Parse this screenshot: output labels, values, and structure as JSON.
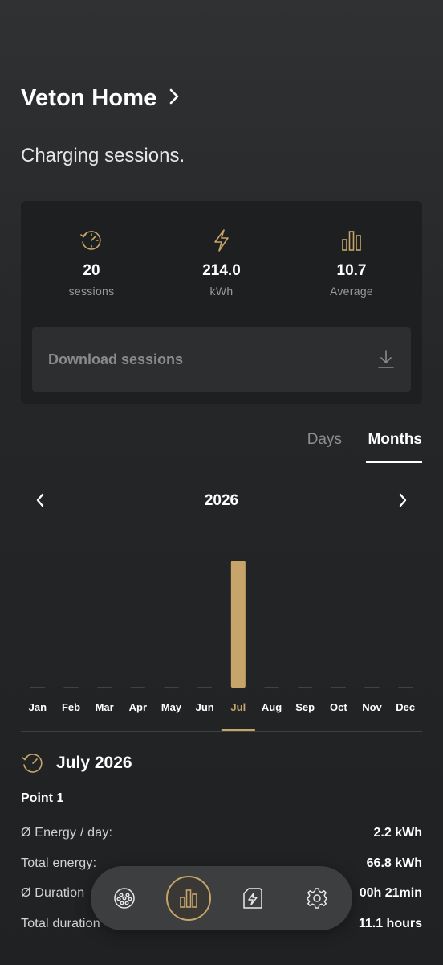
{
  "header": {
    "title": "Veton Home"
  },
  "subtitle": "Charging sessions.",
  "stats": [
    {
      "icon": "history-clock-icon",
      "value": "20",
      "label": "sessions"
    },
    {
      "icon": "lightning-icon",
      "value": "214.0",
      "label": "kWh"
    },
    {
      "icon": "bar-chart-icon",
      "value": "10.7",
      "label": "Average"
    }
  ],
  "download": {
    "label": "Download sessions",
    "icon": "download-icon"
  },
  "tabs": {
    "days": "Days",
    "months": "Months",
    "active": "Months"
  },
  "year_nav": {
    "year": "2026"
  },
  "colors": {
    "accent": "#c6a46a",
    "card": "#1d1f21",
    "background": "#2a2c2e"
  },
  "chart_data": {
    "type": "bar",
    "categories": [
      "Jan",
      "Feb",
      "Mar",
      "Apr",
      "May",
      "Jun",
      "Jul",
      "Aug",
      "Sep",
      "Oct",
      "Nov",
      "Dec"
    ],
    "values": [
      0,
      0,
      0,
      0,
      0,
      0,
      66.8,
      0,
      0,
      0,
      0,
      0
    ],
    "selected": "Jul",
    "ylim": [
      0,
      70
    ],
    "grid": false
  },
  "period": {
    "title": "July 2026"
  },
  "details": {
    "point_name": "Point 1",
    "rows": [
      {
        "label": "Ø Energy / day:",
        "value": "2.2 kWh"
      },
      {
        "label": "Total energy:",
        "value": "66.8 kWh"
      },
      {
        "label": "Ø Duration",
        "value": "00h 21min"
      },
      {
        "label": "Total duration",
        "value": "11.1 hours"
      }
    ]
  },
  "bottom_nav": [
    {
      "icon": "charger-plug-icon",
      "active": false
    },
    {
      "icon": "bar-chart-icon",
      "active": true
    },
    {
      "icon": "energy-device-icon",
      "active": false
    },
    {
      "icon": "gear-icon",
      "active": false
    }
  ]
}
